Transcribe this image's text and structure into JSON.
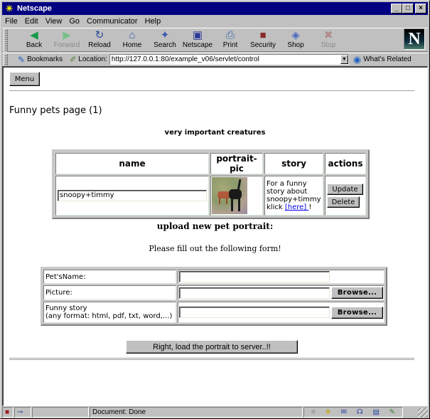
{
  "window": {
    "title": "Netscape",
    "controls": {
      "minimize": "_",
      "maximize": "□",
      "close": "×"
    }
  },
  "menubar": {
    "items": [
      {
        "label": "File",
        "accel": "F"
      },
      {
        "label": "Edit",
        "accel": "E"
      },
      {
        "label": "View",
        "accel": "V"
      },
      {
        "label": "Go",
        "accel": "G"
      },
      {
        "label": "Communicator",
        "accel": "C"
      },
      {
        "label": "Help",
        "accel": "H"
      }
    ]
  },
  "toolbar": {
    "buttons": [
      {
        "label": "Back",
        "icon": "back-arrow-icon",
        "glyph": "◀",
        "color": "#1a9a4a",
        "enabled": true
      },
      {
        "label": "Forward",
        "icon": "forward-arrow-icon",
        "glyph": "▶",
        "color": "#7abf8a",
        "enabled": false
      },
      {
        "label": "Reload",
        "icon": "reload-icon",
        "glyph": "↻",
        "color": "#2a4a9a",
        "enabled": true
      },
      {
        "label": "Home",
        "icon": "home-icon",
        "glyph": "⌂",
        "color": "#3a5ab0",
        "enabled": true
      },
      {
        "label": "Search",
        "icon": "search-icon",
        "glyph": "🔦",
        "color": "#3a5ab0",
        "enabled": true
      },
      {
        "label": "Netscape",
        "icon": "netscape-icon",
        "glyph": "▣",
        "color": "#2a3a9a",
        "enabled": true
      },
      {
        "label": "Print",
        "icon": "print-icon",
        "glyph": "⎙",
        "color": "#3a6ab0",
        "enabled": true
      },
      {
        "label": "Security",
        "icon": "security-lock-icon",
        "glyph": "🔓",
        "color": "#8a2a2a",
        "enabled": true
      },
      {
        "label": "Shop",
        "icon": "shop-bag-icon",
        "glyph": "◈",
        "color": "#4a6ac0",
        "enabled": true
      },
      {
        "label": "Stop",
        "icon": "stop-icon",
        "glyph": "✖",
        "color": "#b08a8a",
        "enabled": false
      }
    ],
    "logo": "N"
  },
  "location_bar": {
    "bookmarks_label": "Bookmarks",
    "location_label": "Location:",
    "url": "http://127.0.0.1:80/example_v06/servlet/control",
    "whats_related_label": "What's Related"
  },
  "page": {
    "menu_button": "Menu",
    "title": "Funny pets page (1)",
    "table_caption": "very important creatures",
    "pets_table": {
      "headers": [
        "name",
        "portrait-pic",
        "story",
        "actions"
      ],
      "rows": [
        {
          "name": "snoopy+timmy",
          "story_prefix": "For a funny story about snoopy+timmy klick ",
          "story_link": "[here] ",
          "story_suffix": "!",
          "actions": [
            "Update",
            "Delete"
          ]
        }
      ]
    },
    "upload_title": "upload new pet portrait:",
    "upload_subtitle": "Please fill out the following form!",
    "form": {
      "pet_name_label": "Pet'sName:",
      "pet_name_value": "",
      "picture_label": "Picture:",
      "picture_value": "",
      "story_label_line1": "Funny story",
      "story_label_line2": "(any format: html, pdf, txt, word,...)",
      "story_value": "",
      "browse_label": "Browse..."
    },
    "submit_label": "Right, load the portrait to server..!!"
  },
  "status_bar": {
    "status_text": "Document: Done"
  }
}
